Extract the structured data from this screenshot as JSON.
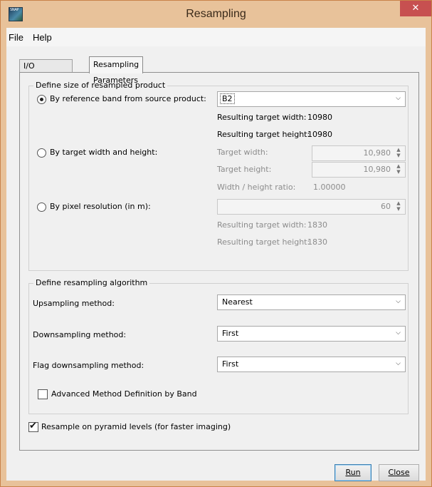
{
  "window": {
    "title": "Resampling",
    "close_label": "✕",
    "app_icon_text": "SNAP"
  },
  "menu": {
    "items": [
      "File",
      "Help"
    ]
  },
  "tabs": [
    "I/O Parameters",
    "Resampling Parameters"
  ],
  "size_group": {
    "title": "Define size of resampled product",
    "by_reference": {
      "label": "By reference band from source product:",
      "selected": true,
      "band_value": "B2",
      "result_width_label": "Resulting target width:",
      "result_width_value": "10980",
      "result_height_label": "Resulting target height:",
      "result_height_value": "10980"
    },
    "by_width_height": {
      "label": "By target width and height:",
      "selected": false,
      "width_label": "Target width:",
      "width_value": "10,980",
      "height_label": "Target height:",
      "height_value": "10,980",
      "ratio_label": "Width / height ratio:",
      "ratio_value": "1.00000"
    },
    "by_resolution": {
      "label": "By pixel resolution (in m):",
      "selected": false,
      "resolution_value": "60",
      "result_width_label": "Resulting target width:",
      "result_width_value": "1830",
      "result_height_label": "Resulting target height:",
      "result_height_value": "1830"
    }
  },
  "algorithm_group": {
    "title": "Define resampling algorithm",
    "upsampling_label": "Upsampling method:",
    "upsampling_value": "Nearest",
    "downsampling_label": "Downsampling method:",
    "downsampling_value": "First",
    "flag_downsampling_label": "Flag downsampling method:",
    "flag_downsampling_value": "First",
    "advanced_label": "Advanced Method Definition by Band",
    "advanced_checked": false
  },
  "pyramid": {
    "label": "Resample on pyramid levels (for faster imaging)",
    "checked": true
  },
  "buttons": {
    "run": "Run",
    "close": "Close"
  }
}
